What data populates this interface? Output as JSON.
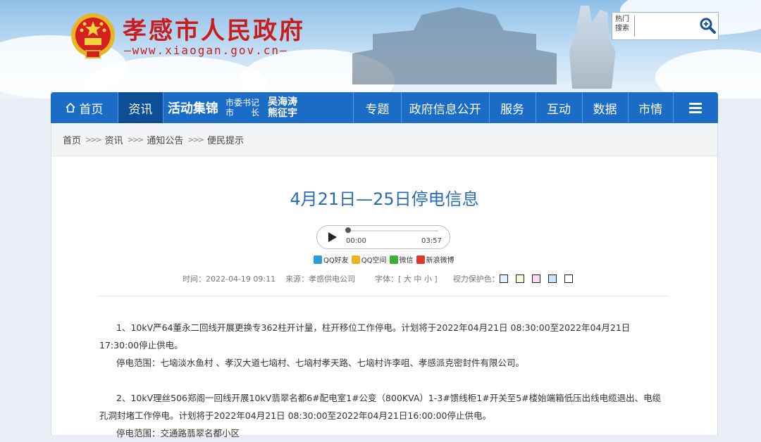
{
  "header": {
    "site_title": "孝感市人民政府",
    "site_url": "—www.xiaogan.gov.cn—",
    "search": {
      "label": "热门搜索",
      "value": ""
    }
  },
  "nav": {
    "home": "首页",
    "news": "资讯",
    "activity_title": "活动集锦",
    "activity_roles": [
      "市委书记",
      "市　　长"
    ],
    "activity_names": [
      "吴海涛",
      "熊征宇"
    ],
    "topics": "专题",
    "gov_info": "政府信息公开",
    "service": "服务",
    "interact": "互动",
    "data": "数据",
    "city": "市情"
  },
  "breadcrumb": [
    "首页",
    "资讯",
    "通知公告",
    "便民提示"
  ],
  "article": {
    "title": "4月21日—25日停电信息",
    "player": {
      "current": "00:00",
      "duration": "03:57",
      "progress": 0
    },
    "share": [
      "QQ好友",
      "QQ空间",
      "微信",
      "新浪微博"
    ],
    "meta": {
      "time": "时间：2022-04-19 09:11",
      "source": "来源：孝感供电公司",
      "font": "字体：[ 大 中 小 ]",
      "eye_label": "视力保护色："
    },
    "eye_colors": [
      "#dff4fb",
      "#fbf7d6",
      "#f6d9f1",
      "#cfe2fa",
      "#ffffff"
    ],
    "paragraphs": [
      "1、10kV严64董永二回线开展更换专362柱开计量，柱开移位工作停电。计划将于2022年04月21日 08:30:00至2022年04月21日17:30:00停止供电。",
      "停电范围：七垴淡水鱼村 、孝汉大道七垴村、七垴村孝天路、七垴村许李咀、孝感派克密封件有限公司。",
      "2、10kV理丝506郑阁一回线开展10kV翡翠名都6#配电室1#公变（800KVA）1-3#馈线柜1#开关至5#楼始端箱低压出线电缆退出、电缆孔洞封堵工作停电。计划将于2022年04月21日 08:30:00至2022年04月21日16:00:00停止供电。",
      "停电范围：交通路翡翠名都小区"
    ]
  }
}
